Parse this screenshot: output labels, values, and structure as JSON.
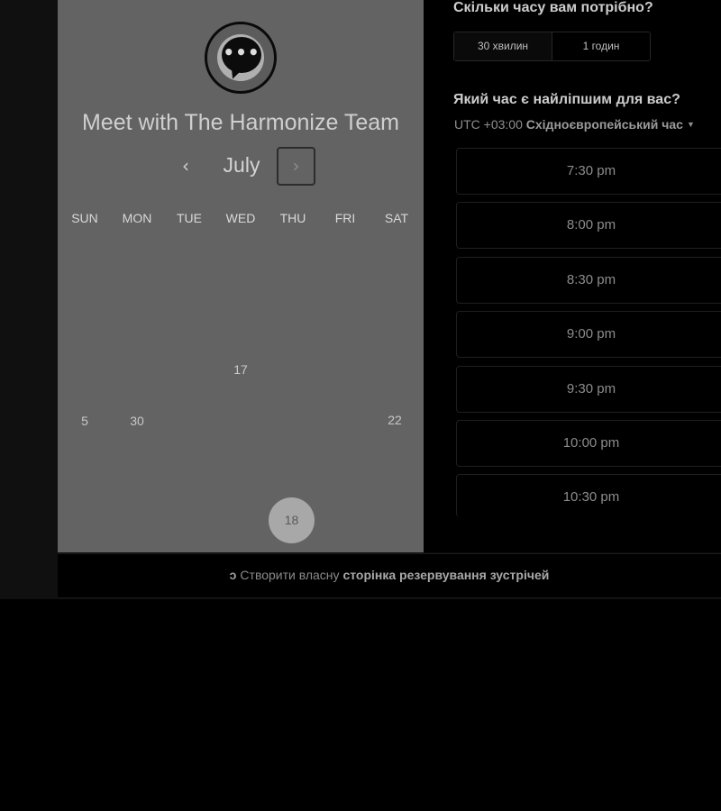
{
  "meeting": {
    "title": "Meet with The Harmonize Team",
    "logo_icon": "chat-bubble-dots-icon"
  },
  "calendar": {
    "month": "July",
    "prev_icon": "chevron-left-icon",
    "next_icon": "chevron-right-icon",
    "weekdays": [
      "SUN",
      "MON",
      "TUE",
      "WED",
      "THU",
      "FRI",
      "SAT"
    ],
    "visible_days": [
      "17",
      "5",
      "30",
      "22"
    ],
    "selected_day": "18"
  },
  "duration": {
    "heading": "Скільки часу вам потрібно?",
    "options": [
      "30 хвилин",
      "1 годин"
    ],
    "selected": "30 хвилин"
  },
  "time": {
    "heading": "Який час є найліпшим для вас?",
    "timezone_prefix": "UTC +03:00",
    "timezone_name": "Східноєвропейський час",
    "slots": [
      "7:30 pm",
      "8:00 pm",
      "8:30 pm",
      "9:00 pm",
      "9:30 pm",
      "10:00 pm",
      "10:30 pm"
    ]
  },
  "footer": {
    "icon": "hubspot-sprocket-icon",
    "prefix": "Створити власну",
    "link": "сторінка резервування зустрічей"
  },
  "colors": {
    "left_panel": "#636363",
    "background": "#000000",
    "selected_day": "#a8a8a8"
  }
}
